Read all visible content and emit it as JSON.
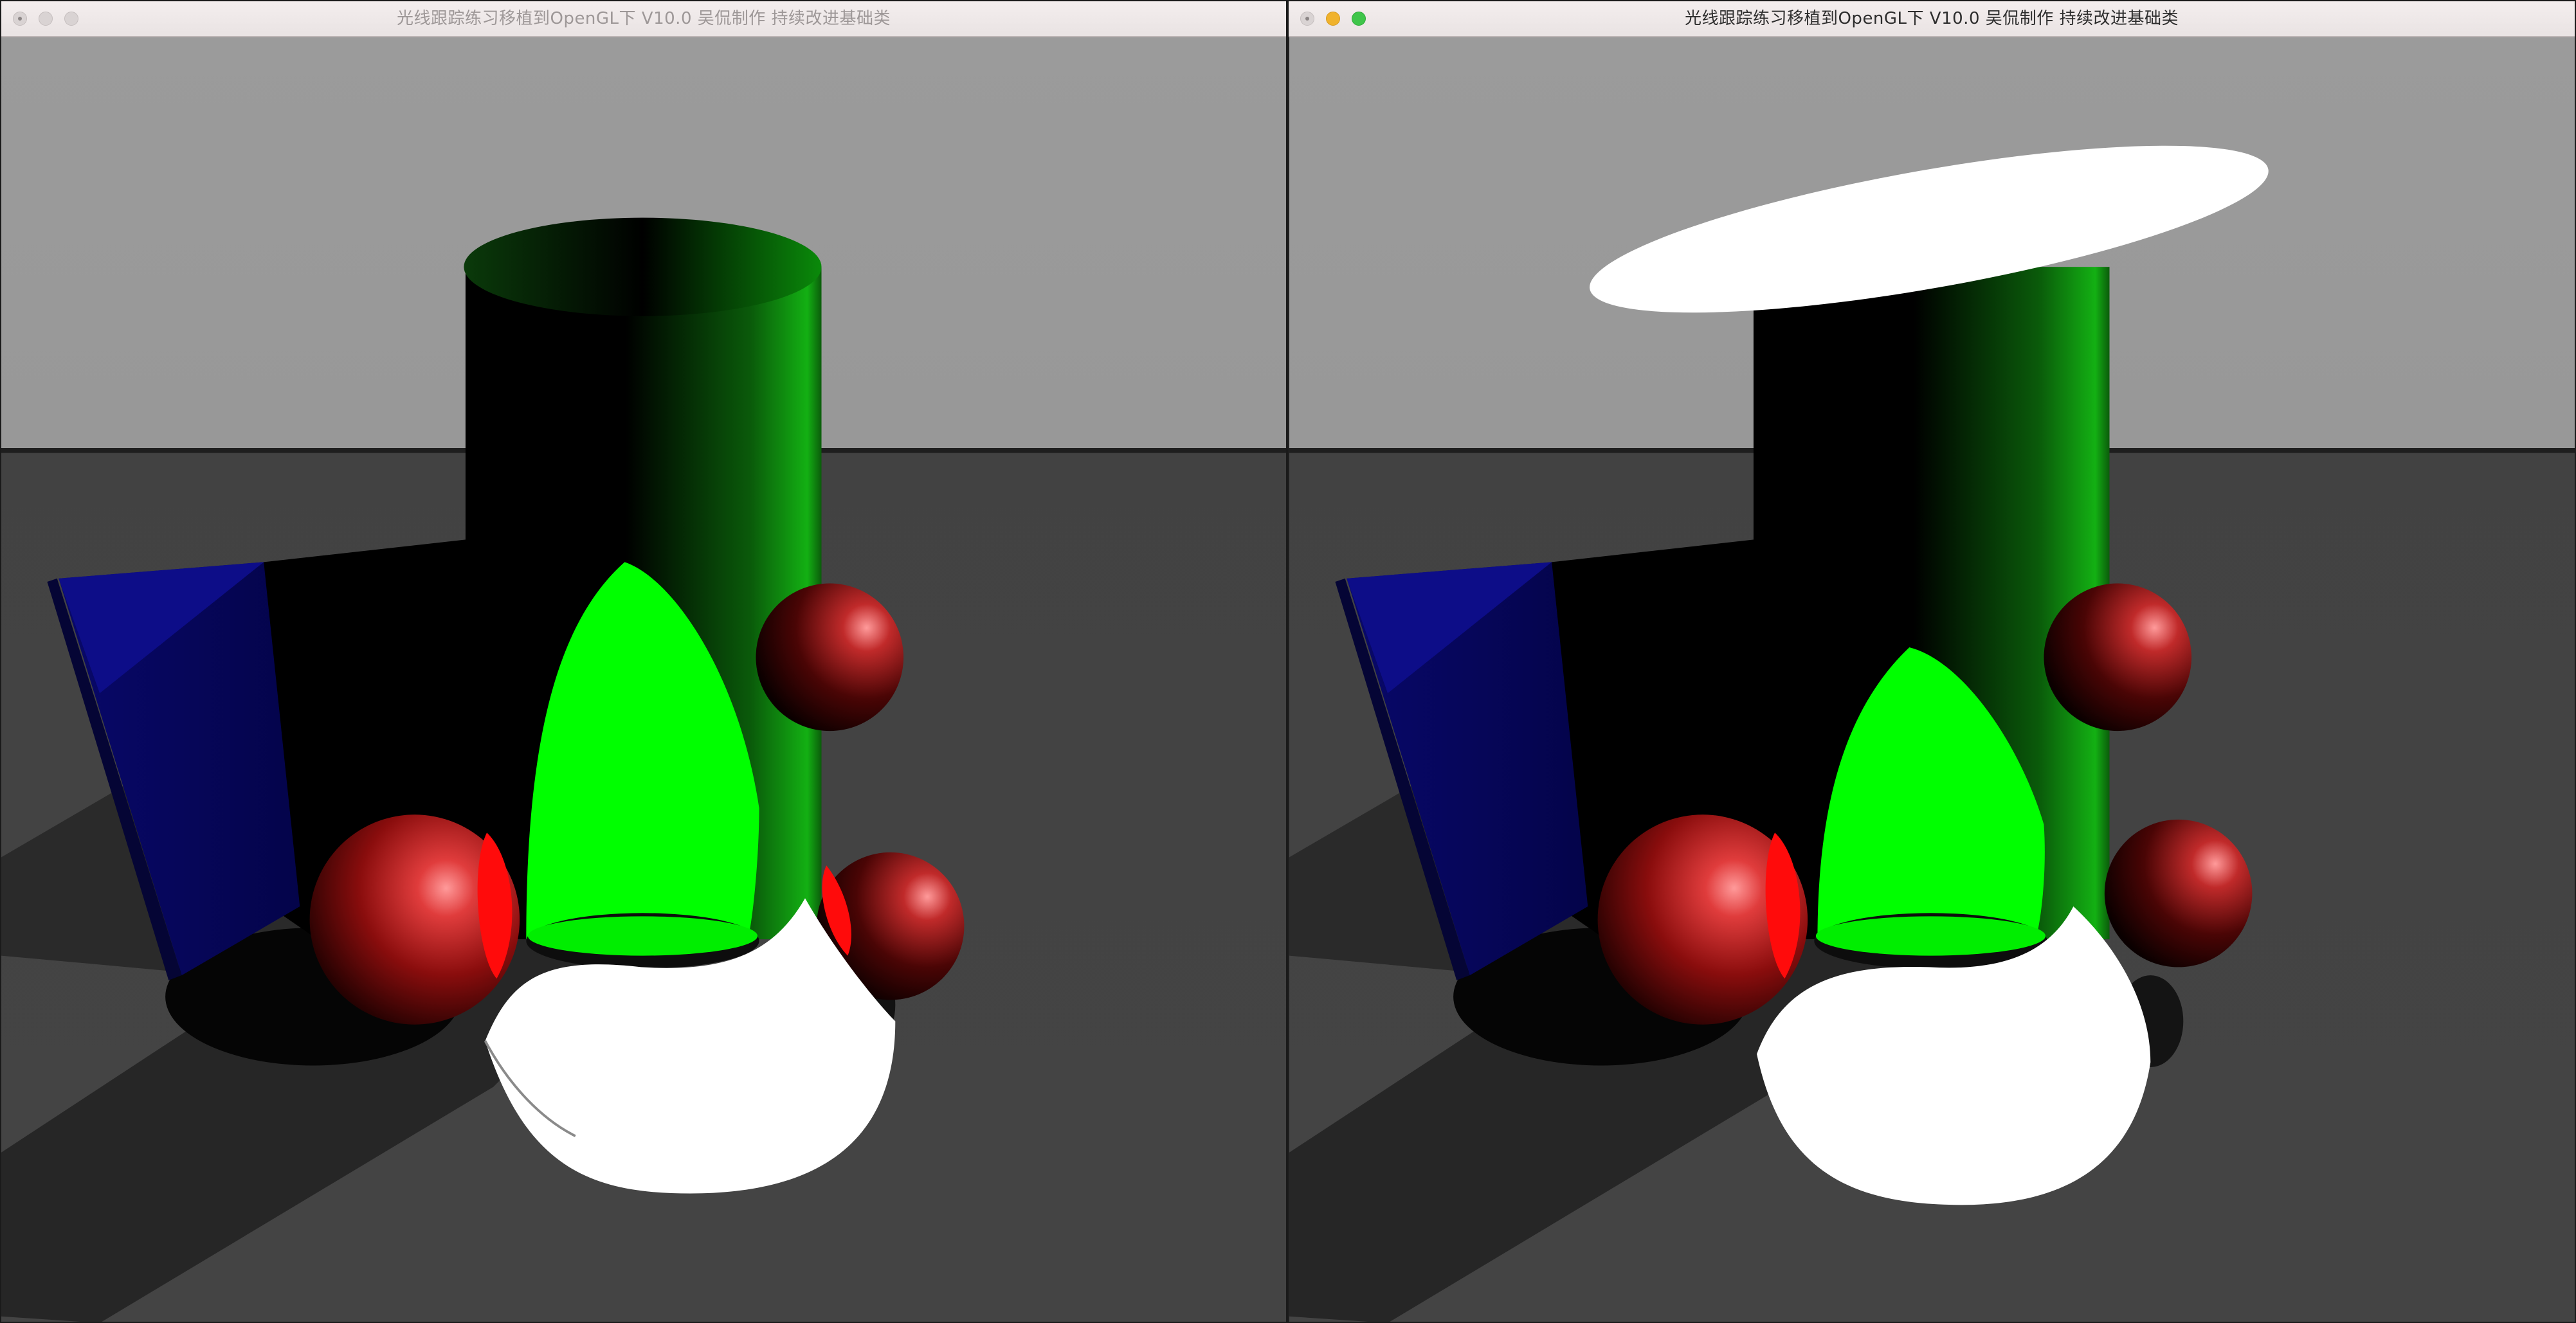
{
  "windows": [
    {
      "title": "光线跟踪练习移植到OpenGL下 V10.0 吴侃制作 持续改进基础类",
      "active": false,
      "disk_visible": false
    },
    {
      "title": "光线跟踪练习移植到OpenGL下 V10.0 吴侃制作 持续改进基础类",
      "active": true,
      "disk_visible": true
    }
  ],
  "colors": {
    "sky": "#9a9a9a",
    "floor": "#3f3f3f",
    "cylinder": "#00ff00",
    "spheres": "#c41414",
    "panel": "#1010a0",
    "disk": "#ffffff"
  }
}
